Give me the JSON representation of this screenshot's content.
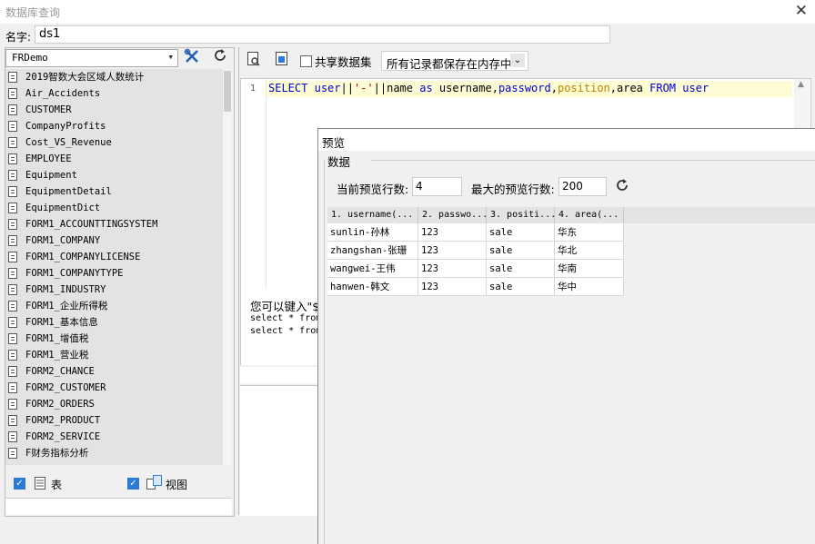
{
  "window": {
    "title": "数据库查询"
  },
  "name_field": {
    "label": "名字:",
    "value": "ds1"
  },
  "connection": {
    "selected": "FRDemo"
  },
  "tables": [
    "2019智数大会区域人数统计",
    "Air_Accidents",
    "CUSTOMER",
    "CompanyProfits",
    "Cost_VS_Revenue",
    "EMPLOYEE",
    "Equipment",
    "EquipmentDetail",
    "EquipmentDict",
    "FORM1_ACCOUNTTINGSYSTEM",
    "FORM1_COMPANY",
    "FORM1_COMPANYLICENSE",
    "FORM1_COMPANYTYPE",
    "FORM1_INDUSTRY",
    "FORM1_企业所得税",
    "FORM1_基本信息",
    "FORM1_增值税",
    "FORM1_营业税",
    "FORM2_CHANCE",
    "FORM2_CUSTOMER",
    "FORM2_ORDERS",
    "FORM2_PRODUCT",
    "FORM2_SERVICE",
    "F财务指标分析"
  ],
  "filters": {
    "tables_label": "表",
    "views_label": "视图"
  },
  "sql_toolbar": {
    "shared_label": "共享数据集",
    "cache_mode": "所有记录都保存在内存中"
  },
  "editor": {
    "line_number": "1",
    "tokens": [
      {
        "t": "SELECT",
        "c": "kw"
      },
      {
        "t": " "
      },
      {
        "t": "user",
        "c": "kw"
      },
      {
        "t": "||"
      },
      {
        "t": "'-'",
        "c": "str"
      },
      {
        "t": "||"
      },
      {
        "t": "name"
      },
      {
        "t": " "
      },
      {
        "t": "as",
        "c": "kw"
      },
      {
        "t": " username,"
      },
      {
        "t": "password",
        "c": "kw"
      },
      {
        "t": ","
      },
      {
        "t": "position",
        "c": "fn"
      },
      {
        "t": ",area "
      },
      {
        "t": "FROM",
        "c": "kw"
      },
      {
        "t": " "
      },
      {
        "t": "user",
        "c": "kw"
      }
    ]
  },
  "hint": {
    "line1": "您可以键入\"$",
    "line2": "select * from",
    "line3": "select * from"
  },
  "preview": {
    "title": "预览",
    "section": "数据",
    "current_rows_label": "当前预览行数:",
    "current_rows": "4",
    "max_rows_label": "最大的预览行数:",
    "max_rows": "200",
    "columns": [
      "1. username(...",
      "2. passwo...",
      "3. positi...",
      "4. area(..."
    ],
    "rows": [
      [
        "sunlin-孙林",
        "123",
        "sale",
        "华东"
      ],
      [
        "zhangshan-张珊",
        "123",
        "sale",
        "华北"
      ],
      [
        "wangwei-王伟",
        "123",
        "sale",
        "华南"
      ],
      [
        "hanwen-韩文",
        "123",
        "sale",
        "华中"
      ]
    ]
  },
  "colors": {
    "checkbox_accent": "#2b7bd6",
    "current_line": "#fefcd4",
    "keyword": "#0000cc"
  }
}
